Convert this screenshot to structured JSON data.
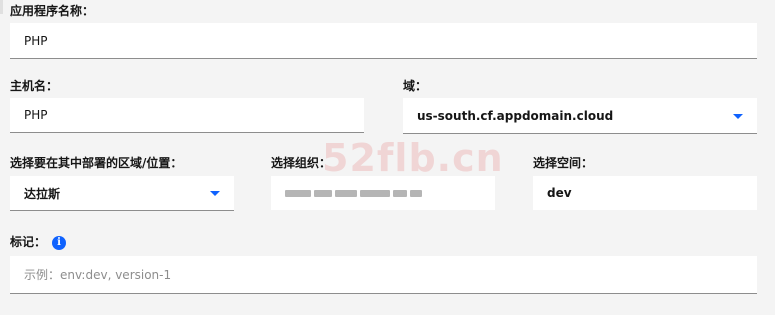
{
  "form": {
    "app_name": {
      "label": "应用程序名称：",
      "value": "PHP"
    },
    "host_name": {
      "label": "主机名：",
      "value": "PHP"
    },
    "domain": {
      "label": "域：",
      "value": "us-south.cf.appdomain.cloud"
    },
    "region": {
      "label": "选择要在其中部署的区域/位置：",
      "value": "达拉斯"
    },
    "organization": {
      "label": "选择组织："
    },
    "space": {
      "label": "选择空间：",
      "value": "dev"
    },
    "tags": {
      "label": "标记：",
      "placeholder": "示例：env:dev, version-1"
    }
  },
  "icons": {
    "info": "info-icon",
    "dropdown": "chevron-down-icon"
  },
  "colors": {
    "accent": "#0f62fe",
    "background": "#f4f4f4",
    "field": "#ffffff"
  },
  "watermark": "52flb.cn"
}
